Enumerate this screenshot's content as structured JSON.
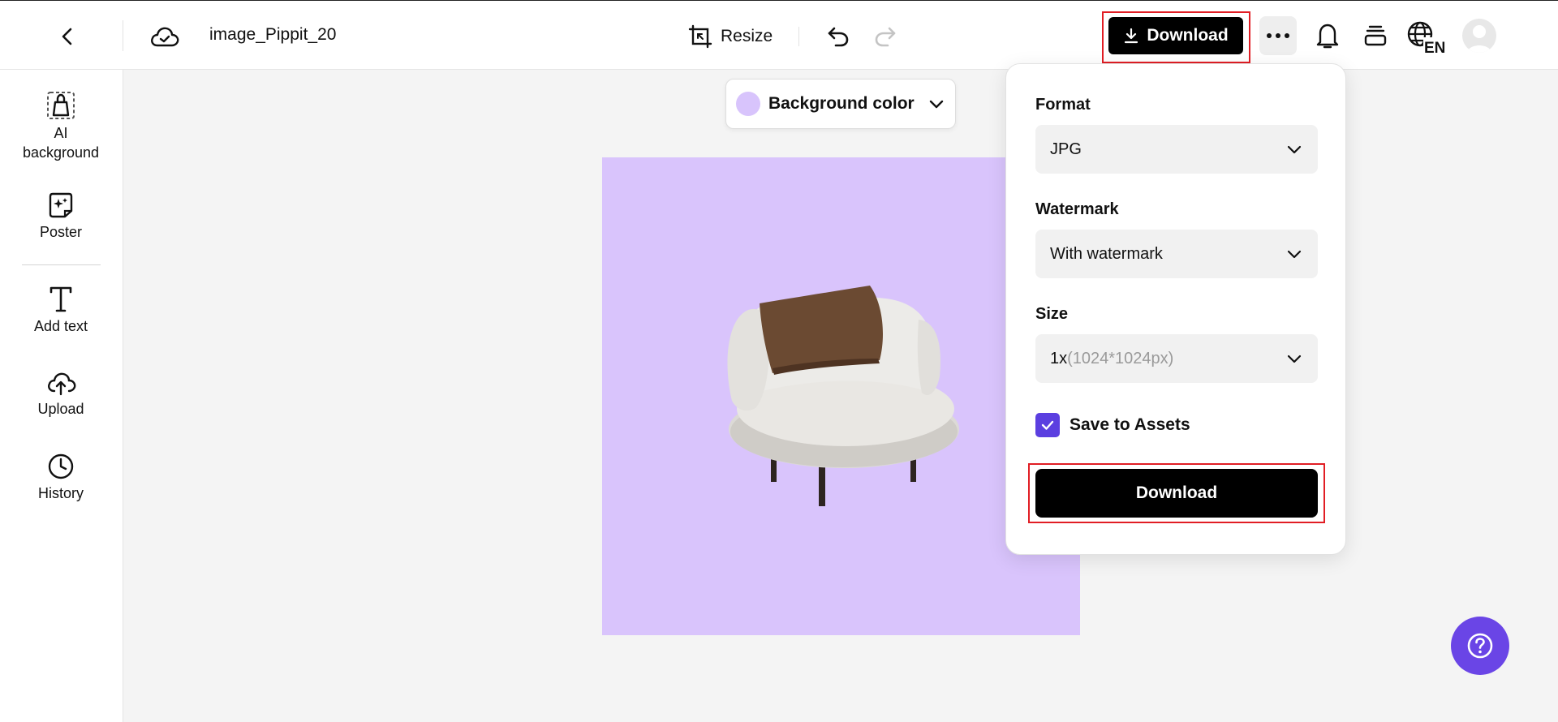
{
  "header": {
    "file_name": "image_Pippit_20",
    "resize_label": "Resize",
    "download_label": "Download",
    "language_code": "EN"
  },
  "sidebar": {
    "items": [
      {
        "label": "AI\nbackground",
        "icon": "ai-background-icon"
      },
      {
        "label": "Poster",
        "icon": "poster-icon"
      },
      {
        "label": "Add text",
        "icon": "text-icon"
      },
      {
        "label": "Upload",
        "icon": "upload-icon"
      },
      {
        "label": "History",
        "icon": "history-icon"
      }
    ]
  },
  "toolbar": {
    "background_color_label": "Background color",
    "swatch_color": "#d8c4fc"
  },
  "canvas": {
    "background": "#d9c4fc"
  },
  "download_panel": {
    "format_label": "Format",
    "format_value": "JPG",
    "watermark_label": "Watermark",
    "watermark_value": "With watermark",
    "size_label": "Size",
    "size_value": "1x",
    "size_detail": "(1024*1024px)",
    "save_to_assets_label": "Save to Assets",
    "save_to_assets_checked": true,
    "download_label": "Download"
  },
  "colors": {
    "accent": "#5b3fe0",
    "highlight": "#e11d24",
    "help_button": "#6a45e6"
  }
}
